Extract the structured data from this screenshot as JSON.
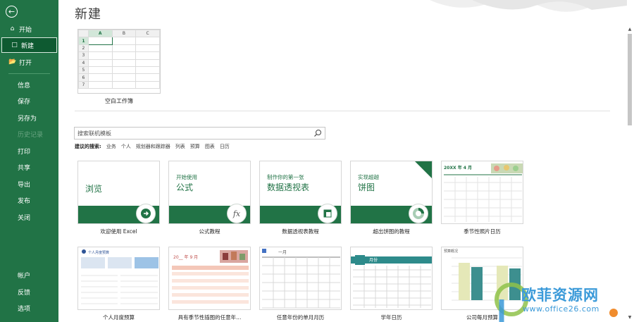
{
  "sidebar": {
    "back_icon": "back-arrow-icon",
    "items": [
      {
        "label": "开始",
        "icon": "home-icon"
      },
      {
        "label": "新建",
        "icon": "new-file-icon"
      },
      {
        "label": "打开",
        "icon": "folder-open-icon"
      },
      {
        "label": "信息"
      },
      {
        "label": "保存"
      },
      {
        "label": "另存为"
      },
      {
        "label": "历史记录"
      },
      {
        "label": "打印"
      },
      {
        "label": "共享"
      },
      {
        "label": "导出"
      },
      {
        "label": "发布"
      },
      {
        "label": "关闭"
      }
    ],
    "bottom_items": [
      {
        "label": "帐户"
      },
      {
        "label": "反馈"
      },
      {
        "label": "选项"
      }
    ],
    "selected": "新建",
    "accent_color": "#217346"
  },
  "main": {
    "title": "新建",
    "blank_workbook": {
      "label": "空白工作簿",
      "columns": [
        "A",
        "B",
        "C"
      ],
      "rows": [
        "1",
        "2",
        "3",
        "4",
        "5",
        "6",
        "7"
      ]
    },
    "search": {
      "placeholder": "搜索联机模板",
      "suggest_label": "建议的搜索:",
      "suggestions": [
        "业务",
        "个人",
        "规划器和跟踪器",
        "列表",
        "预算",
        "图表",
        "日历"
      ]
    },
    "templates": [
      {
        "label": "欢迎使用 Excel",
        "line1": "",
        "line2": "浏览",
        "icon": "arrow-right-icon"
      },
      {
        "label": "公式教程",
        "line1": "开始使用",
        "line2": "公式",
        "icon": "fx-icon"
      },
      {
        "label": "数据透视表教程",
        "line1": "制作你的第一张",
        "line2": "数据透视表",
        "icon": "pivot-table-icon"
      },
      {
        "label": "超出饼图的教程",
        "line1": "实现超越",
        "line2": "饼图",
        "icon": "donut-chart-icon"
      },
      {
        "label": "季节性照片日历",
        "header": "20XX 年 4 月"
      },
      {
        "label": "个人月度预算",
        "header": "个人月度预算"
      },
      {
        "label": "具有季节性插图的任意年...",
        "header": "20__ 年 9 月"
      },
      {
        "label": "任意年份的单月月历",
        "header": "一月"
      },
      {
        "label": "学年日历",
        "header": "月份"
      },
      {
        "label": "公司每月预算",
        "header": "预算概况"
      }
    ]
  },
  "watermark": {
    "text": "欧菲资源网",
    "sub": "www.office26.com"
  }
}
